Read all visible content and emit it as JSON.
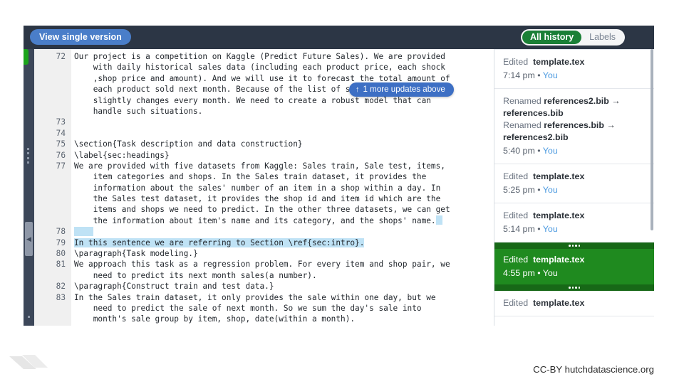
{
  "toolbar": {
    "view_single_version_label": "View single version",
    "toggle": {
      "all_history_label": "All history",
      "labels_label": "Labels"
    }
  },
  "editor": {
    "more_updates_badge": {
      "icon": "arrow-up-icon",
      "arrow": "↑",
      "label": "1 more updates above"
    },
    "lines": [
      {
        "num": "72",
        "text": "Our project is a competition on Kaggle (Predict Future Sales). We are provided"
      },
      {
        "num": "",
        "text": "    with daily historical sales data (including each product price, each shock"
      },
      {
        "num": "",
        "text": "    ,shop price and amount). And we will use it to forecast the total amount of"
      },
      {
        "num": "",
        "text": "    each product sold next month. Because of the list of shops and products"
      },
      {
        "num": "",
        "text": "    slightly changes every month. We need to create a robust model that can"
      },
      {
        "num": "",
        "text": "    handle such situations."
      },
      {
        "num": "73",
        "text": ""
      },
      {
        "num": "74",
        "text": ""
      },
      {
        "num": "75",
        "text": "\\section{Task description and data construction}"
      },
      {
        "num": "76",
        "text": "\\label{sec:headings}"
      },
      {
        "num": "77",
        "text": "We are provided with five datasets from Kaggle: Sales train, Sale test, items,"
      },
      {
        "num": "",
        "text": "    item categories and shops. In the Sales train dataset, it provides the"
      },
      {
        "num": "",
        "text": "    information about the sales' number of an item in a shop within a day. In"
      },
      {
        "num": "",
        "text": "    the Sales test dataset, it provides the shop id and item id which are the"
      },
      {
        "num": "",
        "text": "    items and shops we need to predict. In the other three datasets, we can get"
      },
      {
        "num": "",
        "text": "    the information about item's name and its category, and the shops' name."
      },
      {
        "num": "78",
        "text": ""
      },
      {
        "num": "79",
        "text": "In this sentence we are referring to Section \\ref{sec:intro}."
      },
      {
        "num": "80",
        "text": "\\paragraph{Task modeling.}"
      },
      {
        "num": "81",
        "text": "We approach this task as a regression problem. For every item and shop pair, we"
      },
      {
        "num": "",
        "text": "    need to predict its next month sales(a number)."
      },
      {
        "num": "82",
        "text": "\\paragraph{Construct train and test data.}"
      },
      {
        "num": "83",
        "text": "In the Sales train dataset, it only provides the sale within one day, but we"
      },
      {
        "num": "",
        "text": "    need to predict the sale of next month. So we sum the day's sale into"
      },
      {
        "num": "",
        "text": "    month's sale group by item, shop, date(within a month)."
      }
    ],
    "highlight": {
      "color": "#bfe2f5",
      "added_line_index": 17,
      "caret_line_index": 15,
      "blank_highlight_line_index": 16
    }
  },
  "history": [
    {
      "id": "h1",
      "op_label": "Edited",
      "op_doc": "template.tex",
      "time": "7:14 pm",
      "separator": "•",
      "author": "You",
      "selected": false
    },
    {
      "id": "h2",
      "ops": [
        {
          "op_label": "Renamed",
          "from": "references2.bib",
          "arrow": "→",
          "to": "references.bib"
        },
        {
          "op_label": "Renamed",
          "from": "references.bib",
          "arrow": "→",
          "to": "references2.bib"
        }
      ],
      "time": "5:40 pm",
      "separator": "•",
      "author": "You",
      "selected": false
    },
    {
      "id": "h3",
      "op_label": "Edited",
      "op_doc": "template.tex",
      "time": "5:25 pm",
      "separator": "•",
      "author": "You",
      "selected": false
    },
    {
      "id": "h4",
      "op_label": "Edited",
      "op_doc": "template.tex",
      "time": "5:14 pm",
      "separator": "•",
      "author": "You",
      "selected": false
    },
    {
      "id": "h5",
      "op_label": "Edited",
      "op_doc": "template.tex",
      "time": "4:55 pm",
      "separator": "•",
      "author": "You",
      "selected": true
    },
    {
      "id": "h6",
      "op_label": "Edited",
      "op_doc": "template.tex",
      "time": "",
      "separator": "",
      "author": "",
      "selected": false
    }
  ],
  "footer": {
    "attribution": "CC-BY hutchdatascience.org"
  },
  "colors": {
    "toolbar_bg": "#2c3645",
    "primary_button": "#4a7ec9",
    "active_toggle": "#1a7f36",
    "selected_entry": "#1f8a1f",
    "added_text_highlight": "#bfe2f5",
    "author_link": "#4c9ae0"
  }
}
